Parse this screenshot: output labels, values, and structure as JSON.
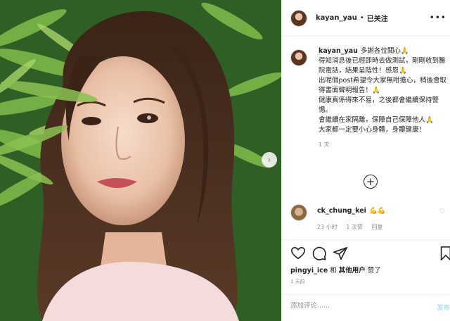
{
  "header": {
    "username": "kayan_yau",
    "separator": "•",
    "follow_state": "已关注",
    "more_icon": "more-horizontal-icon"
  },
  "caption": {
    "username": "kayan_yau",
    "line1": "多謝各位關心🙏",
    "line2": "得知消息後已經即時去做測試，剛剛收到醫院電話，結果呈陰性！感恩🙏",
    "line3": "出呢個post希望令大家無咁擔心，稍後會取得書面聲明報告！🙏",
    "line4": "健康真係得來不易，之後都會繼續保持警惕。",
    "line5": "會繼續在家隔離，保障自己保障他人🙏",
    "line6": "大家都一定要小心身體，身體健康！",
    "time": "1 天"
  },
  "load_more_icon": "plus-circle-icon",
  "comment": {
    "username": "ck_chung_kei",
    "text": "💪💪",
    "time": "23 小时",
    "likes": "1 次赞",
    "reply": "回复"
  },
  "actions": {
    "like_icon": "heart-icon",
    "comment_icon": "comment-icon",
    "share_icon": "share-icon",
    "save_icon": "bookmark-icon"
  },
  "likes": {
    "first_user": "pingyi_ice",
    "connector": "和",
    "others": "其他用户",
    "suffix": "赞了"
  },
  "post_age": "1 天前",
  "add_comment": {
    "placeholder": "添加评论......",
    "post_label": "发布"
  }
}
